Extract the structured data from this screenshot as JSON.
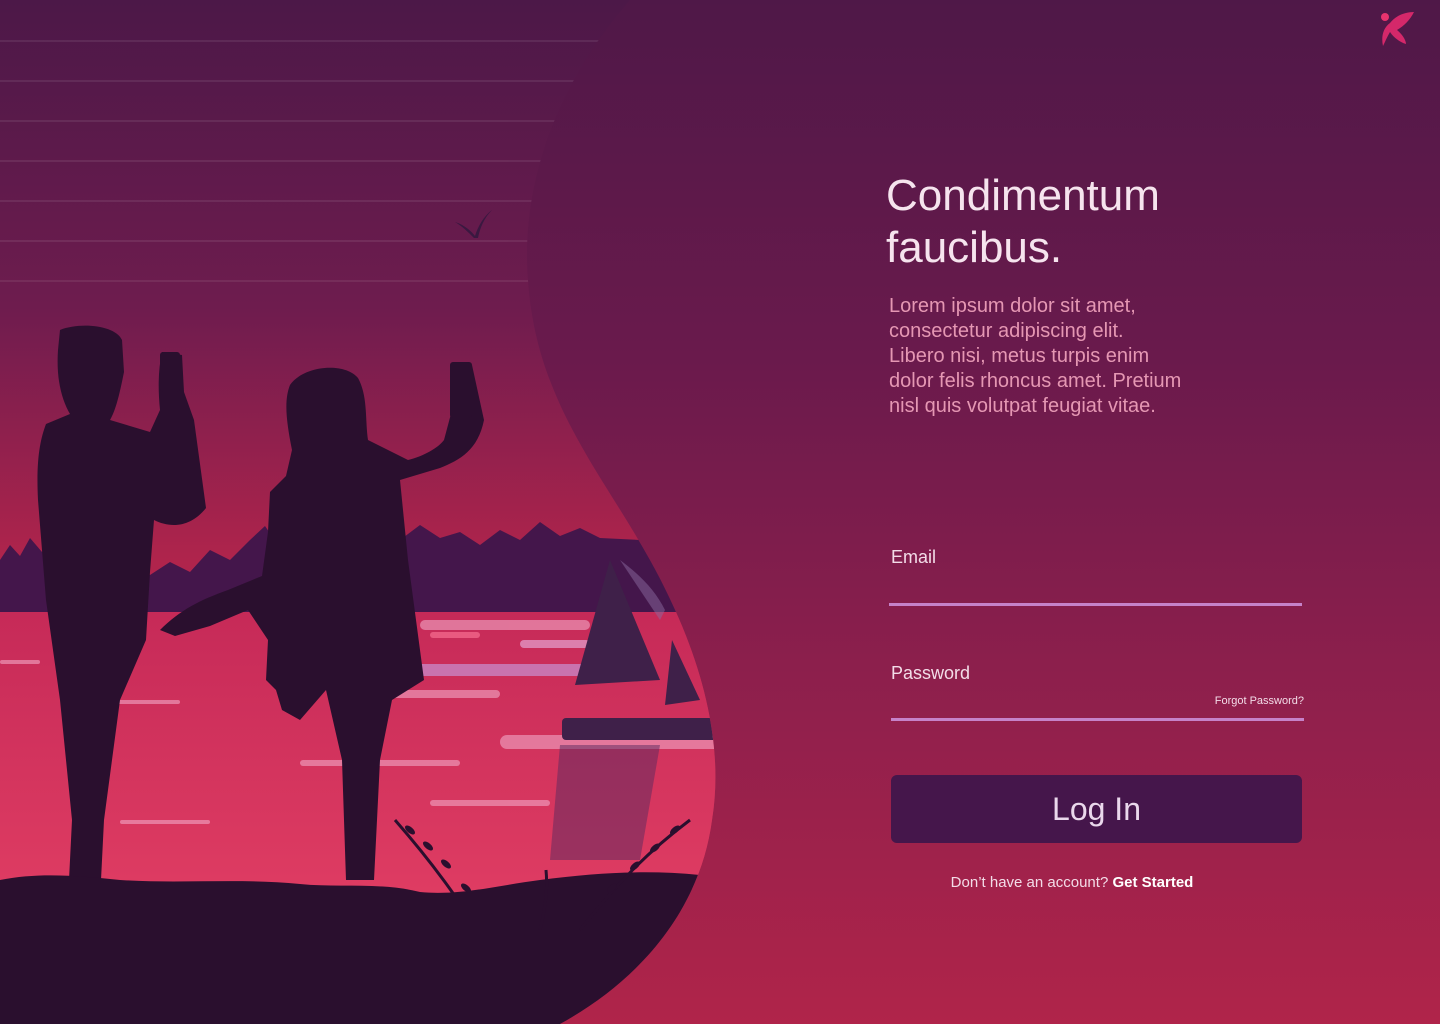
{
  "brand": {
    "logo_icon": "butterfly-logo-icon",
    "accent": "#e8336e"
  },
  "hero": {
    "headline": "Condimentum\nfaucibus.",
    "description": "Lorem ipsum dolor sit amet,\nconsectetur adipiscing elit.\nLibero nisi, metus turpis enim\ndolor felis rhoncus amet. Pretium\nnisl quis volutpat feugiat vitae."
  },
  "form": {
    "email_label": "Email",
    "email_value": "",
    "password_label": "Password",
    "password_value": "",
    "forgot_password": "Forgot Password?",
    "login_button": "Log In",
    "signup_prompt": "Don’t have an account?",
    "signup_link": "Get Started"
  },
  "colors": {
    "background_top": "#4f1848",
    "background_bottom": "#b0244a",
    "button": "#45164b",
    "underline": "#c682c9",
    "silhouette": "#2a0f2e"
  }
}
